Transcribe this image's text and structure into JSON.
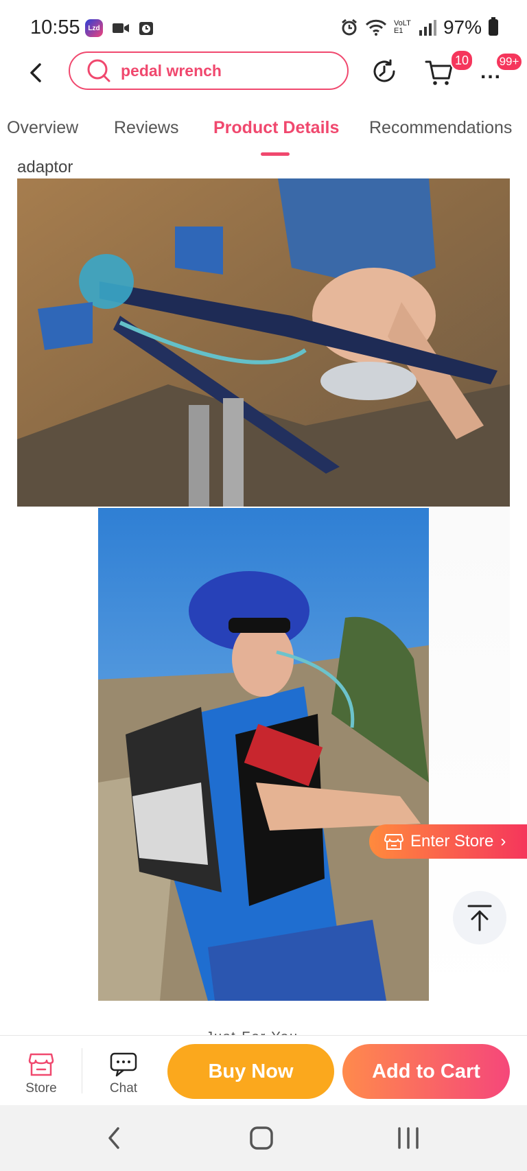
{
  "status_bar": {
    "time": "10:55",
    "lazada_badge": "Lzd",
    "battery": "97%",
    "network": "VoLTE1",
    "icons": [
      "lazada-app-icon",
      "video-icon",
      "alarm-clock-icon",
      "alarm-icon",
      "wifi-icon",
      "signal-icon",
      "battery-icon"
    ]
  },
  "header": {
    "search_text": "pedal wrench",
    "cart_badge": "10",
    "more_badge": "99+",
    "more_label": "..."
  },
  "tabs": [
    {
      "label": "Overview"
    },
    {
      "label": "Reviews"
    },
    {
      "label": "Product Details"
    },
    {
      "label": "Recommendations"
    }
  ],
  "active_tab": "Product Details",
  "content": {
    "caption": "adaptor",
    "partial_text": "Just For You",
    "images": [
      "cyclist-with-hydration-tube-on-handlebar",
      "cyclist-drinking-from-hydration-backpack"
    ]
  },
  "floating": {
    "enter_store": "Enter Store"
  },
  "bottom_bar": {
    "store_label": "Store",
    "chat_label": "Chat",
    "buy_now": "Buy Now",
    "add_to_cart": "Add to Cart"
  },
  "colors": {
    "accent": "#f0486e",
    "buy_now": "#fba81d",
    "badge": "#f5365c"
  }
}
